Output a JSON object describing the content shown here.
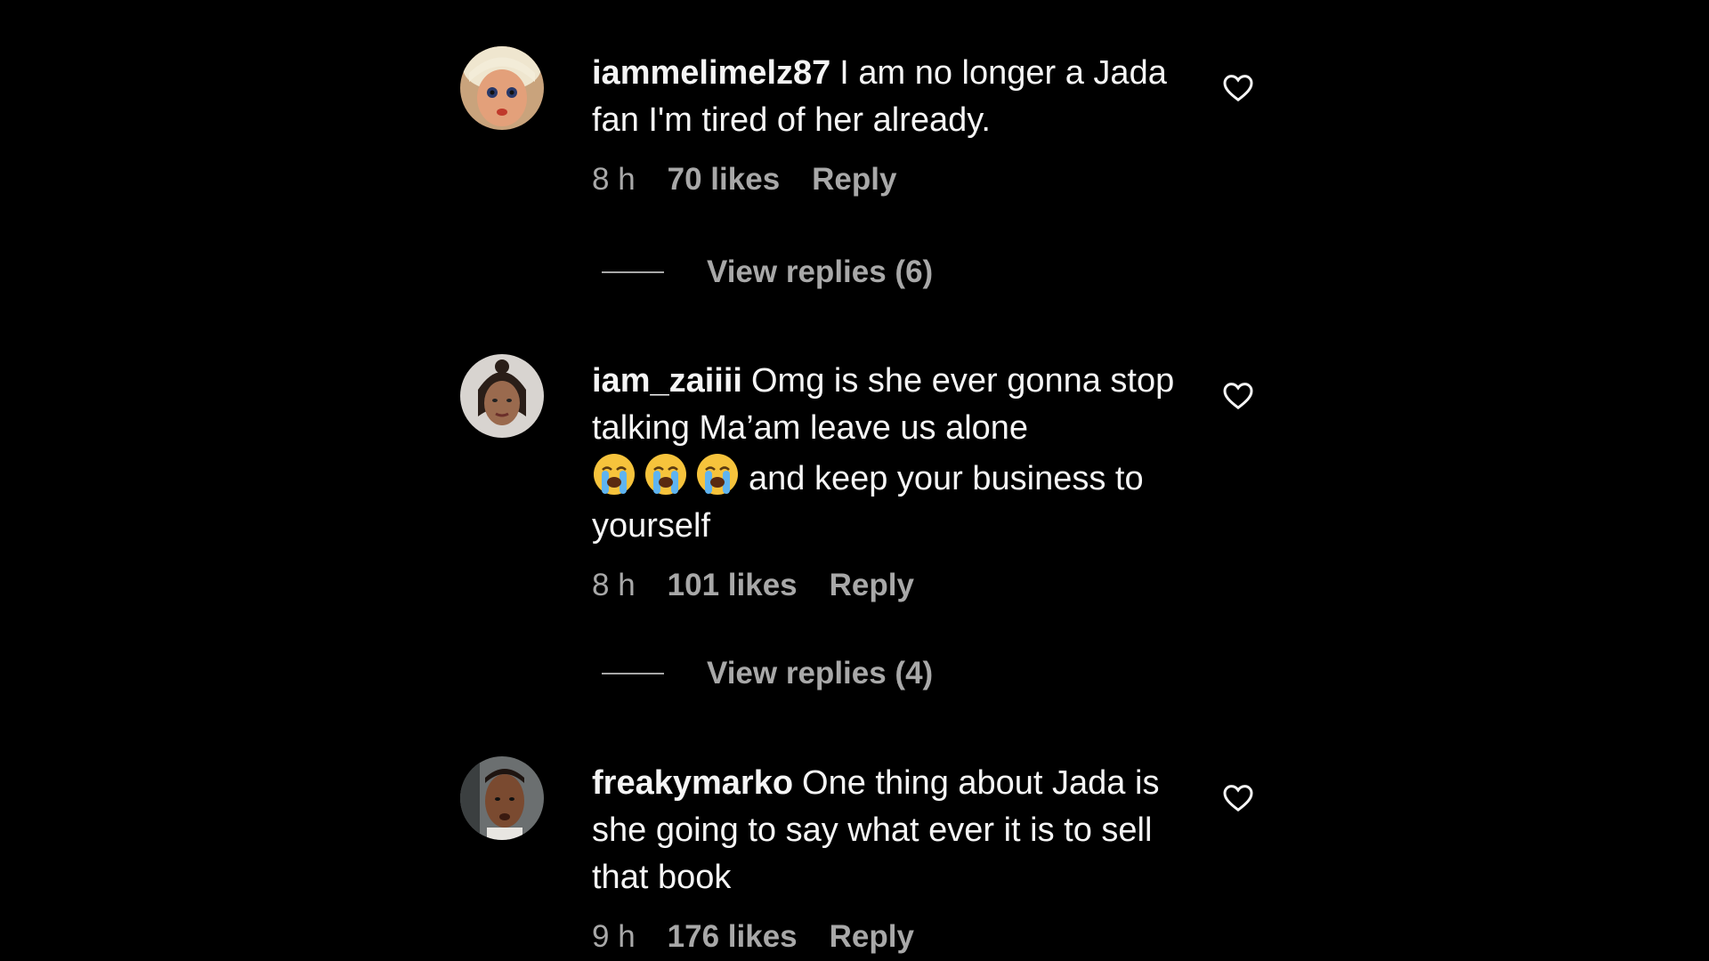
{
  "comments": [
    {
      "username": "iammelimelz87",
      "text": "I am no longer a Jada fan I'm tired of her already.",
      "time": "8 h",
      "likes": "70 likes",
      "reply_label": "Reply",
      "avatar_icon": "doll-face-avatar"
    },
    {
      "username": "iam_zaiiii",
      "text_before_emoji": "Omg is she ever gonna stop talking Ma’am leave us alone",
      "emojis": [
        "loudly-crying-face",
        "loudly-crying-face",
        "loudly-crying-face"
      ],
      "text_after_emoji": "and keep your business to yourself",
      "time": "8 h",
      "likes": "101 likes",
      "reply_label": "Reply",
      "avatar_icon": "woman-avatar"
    },
    {
      "username": "freakymarko",
      "text": "One thing about Jada is she going to say what ever it is to sell that book",
      "time": "9 h",
      "likes": "176 likes",
      "reply_label": "Reply",
      "avatar_icon": "man-avatar"
    }
  ],
  "view_replies": [
    {
      "label": "View replies (6)"
    },
    {
      "label": "View replies (4)"
    }
  ],
  "colors": {
    "background": "#000000",
    "primary_text": "#f5f5f5",
    "secondary_text": "#a8a8a8"
  }
}
